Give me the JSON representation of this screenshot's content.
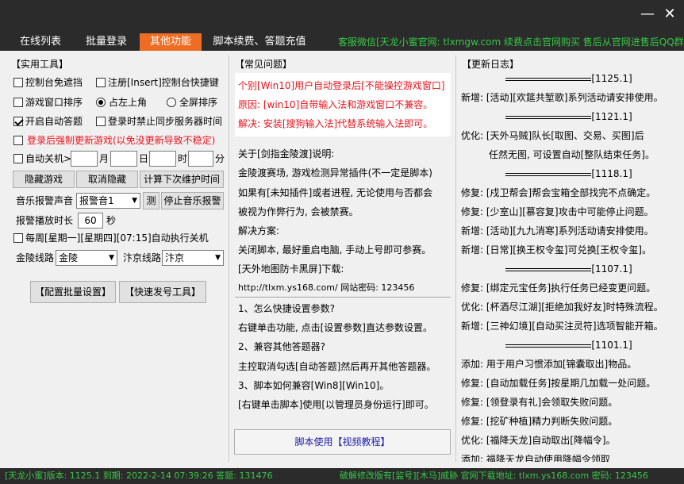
{
  "window": {
    "minimize_label": "—",
    "close_label": "✕"
  },
  "tabs": [
    {
      "label": "在线列表"
    },
    {
      "label": "批量登录"
    },
    {
      "label": "其他功能"
    },
    {
      "label": "脚本续费、答题充值"
    }
  ],
  "notice": "客服微信[天龙小蜜官网: tlxmgw.com 续费点击官网购买 售后从官网进售后QQ群]",
  "tools": {
    "title": "【实用工具】",
    "cb_console_free": "控制台免遮挡",
    "cb_register_insert": "注册[Insert]控制台快捷键",
    "cb_window_sort": "游戏窗口排序",
    "rb_top_left": "占左上角",
    "rb_full_screen": "全屏排序",
    "cb_auto_answer": "开启自动答题",
    "cb_login_block": "登录时禁止同步服务器时间",
    "cb_force_update": "登录后强制更新游戏(以免没更新导致不稳定)",
    "cb_auto_shutdown": "自动关机>",
    "unit_month": "月",
    "unit_day": "日",
    "unit_hour": "时",
    "unit_minute": "分",
    "btn_hide_game": "隐藏游戏",
    "btn_cancel_hide": "取消隐藏",
    "btn_calc_maint": "计算下次维护时间",
    "music_label": "音乐报警声音",
    "music_select": "报警音1",
    "btn_test": "测",
    "btn_stop_music": "停止音乐报警",
    "duration_label": "报警播放时长",
    "duration_value": "60",
    "duration_unit": "秒",
    "cb_weekly_shutdown": "每周[星期一][星期四][07:15]自动执行关机",
    "jinling_label": "金陵线路",
    "jinling_value": "金陵",
    "bianjing_label": "汴京线路",
    "bianjing_value": "汴京",
    "btn_batch_config": "【配置批量设置】",
    "btn_quick_tool": "【快速发号工具】"
  },
  "faq": {
    "title": "【常见问题】",
    "red_lines": [
      "个别[Win10]用户自动登录后[不能操控游戏窗口]",
      "原因: [win10]自带输入法和游戏窗口不兼容。",
      "解决: 安装[搜狗输入法]代替系统输入法即可。"
    ],
    "lines_a": [
      "关于[剑指金陵渡]说明:",
      "金陵渡赛场, 游戏检测异常插件(不一定是脚本)",
      "如果有[未知插件]或者进程, 无论使用与否都会",
      "被视为作弊行为, 会被禁赛。",
      "解决方案:",
      "关闭脚本, 最好重启电脑, 手动上号即可参赛。",
      "[天外地图防卡黑屏]下载:",
      "http://tlxm.ys168.com/   网站密码: 123456"
    ],
    "lines_b": [
      "1、怎么快捷设置参数?",
      "右键单击功能, 点击[设置参数]直达参数设置。",
      "2、兼容其他答题器?",
      "主控取消勾选[自动答题]然后再开其他答题器。",
      "3、脚本如何兼容[Win8][Win10]。",
      "[右键单击脚本]使用[以管理员身份运行]即可。"
    ],
    "btn_video": "脚本使用【视频教程】"
  },
  "log": {
    "title": "【更新日志】",
    "entries": [
      {
        "date": "[1125.1]",
        "items": [
          "新增: [活动][欢筵共堑歌]系列活动请安排使用。"
        ]
      },
      {
        "date": "[1121.1]",
        "items": [
          "优化: [天外马贼]队长[取图、交易、买图]后",
          "任然无图, 可设置自动[整队结束任务]。"
        ]
      },
      {
        "date": "[1118.1]",
        "items": [
          "修复: [戍卫帮会]帮会宝箱全部找完不点确定。",
          "修复: [少室山][慕容复]攻击中可能停止问题。",
          "新增: [活动][九九消寒]系列活动请安排使用。",
          "新增: [日常][换王权令玺]可兑换[王权令玺]。"
        ]
      },
      {
        "date": "[1107.1]",
        "items": [
          "修复: [绑定元宝任务]执行任务已经变更问题。",
          "优化: [杯酒尽江湖][拒绝加我好友]时特殊流程。",
          "新增: [三神幻境][自动买注灵符]选项智能开箱。"
        ]
      },
      {
        "date": "[1101.1]",
        "items": [
          "添加: 用于用户习惯添加[锦囊取出]物品。",
          "修复: [自动加载任务]按星期几加载一处问题。",
          "修复: [领登录有礼]会领取失败问题。",
          "修复: [挖矿种植]精力判断失败问题。",
          "优化: [福降天龙]自动取出[降幅令]。",
          "添加: 福降天龙自动使用降幅令领取"
        ]
      }
    ]
  },
  "status": {
    "left": "[天龙小蜜]版本: 1125.1   到期: 2022-2-14 07:39:26   答题: 131476",
    "right": "破解修改版有[监号][木马]威胁 官网下载地址: tlxm.ys168.com 密码: 123456"
  },
  "colors": {
    "accent": "#ee6d24",
    "notice": "#37c646",
    "dark": "#2b2b2b",
    "red": "#e8141e"
  }
}
